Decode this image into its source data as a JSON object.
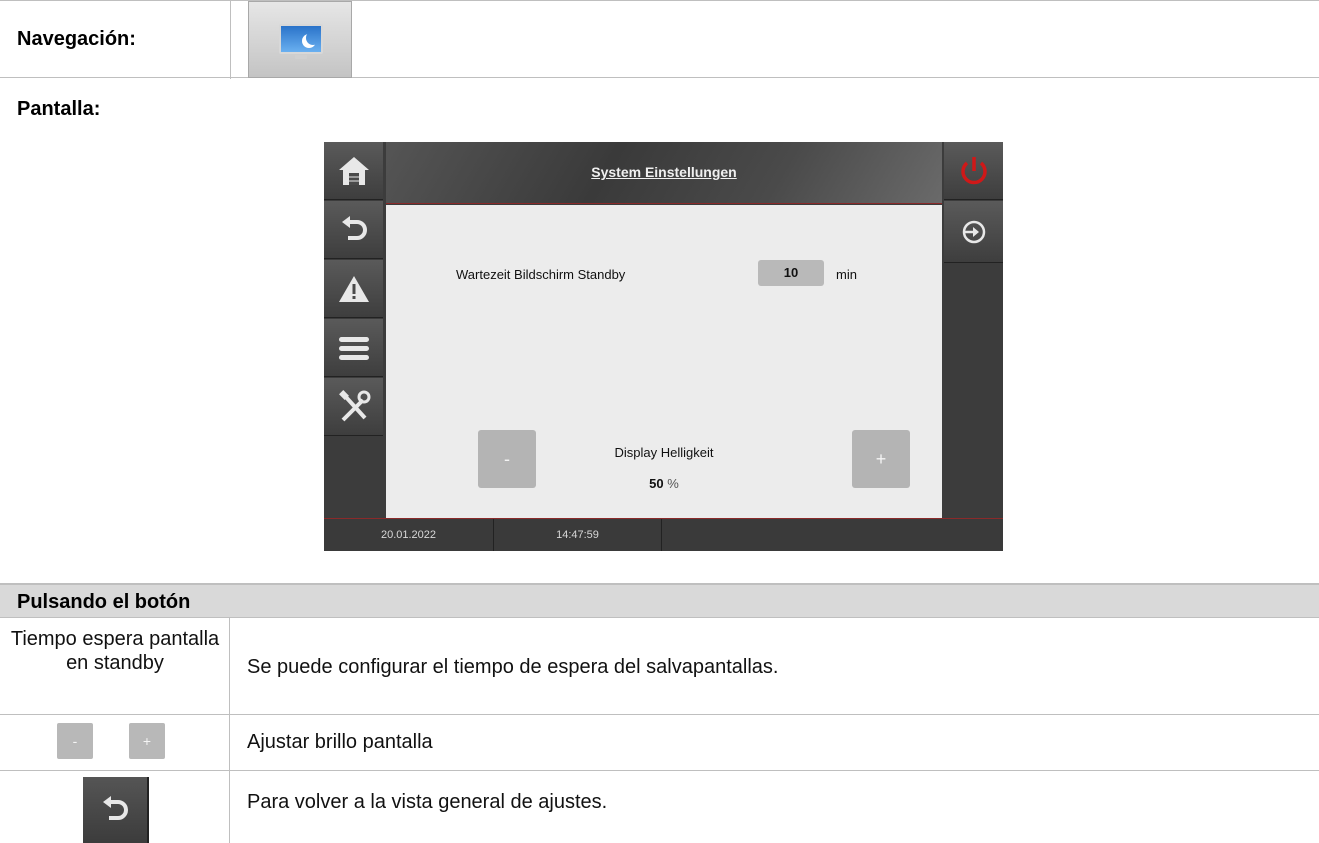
{
  "navigation": {
    "label": "Navegación:",
    "icon": "monitor-moon-icon"
  },
  "screen": {
    "label": "Pantalla:",
    "device": {
      "title": "System Einstellungen",
      "standby_label": "Wartezeit Bildschirm Standby",
      "standby_value": "10",
      "standby_unit": "min",
      "minus_label": "-",
      "plus_label": "+",
      "brightness_label": "Display Helligkeit",
      "brightness_value": "50",
      "brightness_unit": "%",
      "date": "20.01.2022",
      "time": "14:47:59",
      "left_icons": [
        "home-icon",
        "back-icon",
        "warning-icon",
        "menu-icon",
        "tools-icon"
      ],
      "right_icons": [
        "power-icon",
        "login-icon"
      ],
      "colors": {
        "power": "#d01818",
        "accent_line": "#8a2a2a"
      }
    }
  },
  "press": {
    "header": "Pulsando el botón",
    "rows": [
      {
        "left": "Tiempo espera pantalla en standby",
        "desc": "Se puede configurar el tiempo de espera del salvapantallas."
      },
      {
        "minus": "-",
        "plus": "+",
        "desc": "Ajustar brillo pantalla"
      },
      {
        "icon": "back-icon",
        "desc": "Para volver a la vista general de ajustes."
      }
    ]
  }
}
